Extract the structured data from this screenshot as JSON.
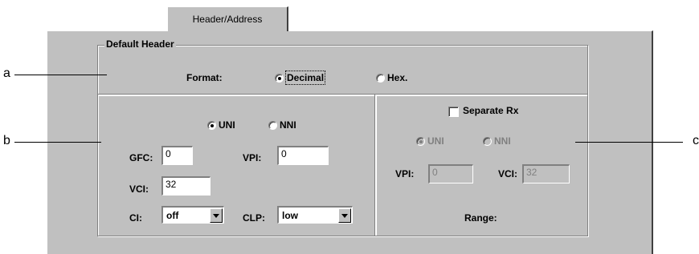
{
  "tab": {
    "label": "Header/Address"
  },
  "group_default_header": {
    "title": "Default Header"
  },
  "format": {
    "label": "Format:",
    "options": [
      "Decimal",
      "Hex."
    ],
    "selected": "Decimal"
  },
  "interface": {
    "options": [
      "UNI",
      "NNI"
    ],
    "selected": "UNI"
  },
  "gfc": {
    "label": "GFC:",
    "value": "0"
  },
  "vpi": {
    "label": "VPI:",
    "value": "0"
  },
  "vci": {
    "label": "VCI:",
    "value": "32"
  },
  "ci": {
    "label": "CI:",
    "value": "off"
  },
  "clp": {
    "label": "CLP:",
    "value": "low"
  },
  "rx": {
    "separate_label": "Separate Rx",
    "separate_checked": false,
    "options": [
      "UNI",
      "NNI"
    ],
    "selected": "UNI",
    "vpi_label": "VPI:",
    "vpi_value": "0",
    "vci_label": "VCI:",
    "vci_value": "32",
    "range_label": "Range:"
  },
  "callouts": {
    "a": "a",
    "b": "b",
    "c": "c"
  }
}
